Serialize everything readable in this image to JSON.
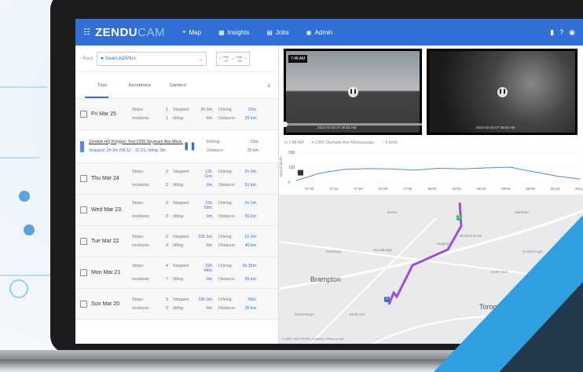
{
  "nav": {
    "logo": "ZENDU",
    "logo_suffix": "CAM",
    "items": [
      {
        "label": "Map",
        "icon": "map-pin-icon"
      },
      {
        "label": "Insights",
        "icon": "chart-icon"
      },
      {
        "label": "Jobs",
        "icon": "document-icon"
      },
      {
        "label": "Admin",
        "icon": "user-icon"
      }
    ]
  },
  "toolbar": {
    "back": "‹ Back",
    "vehicle": "● Sean-ADPlus",
    "date_from_month": "Mar",
    "date_from_day": "20",
    "date_to_month": "Mar",
    "date_to_day": "26"
  },
  "tabs": {
    "trips": "Trips",
    "exceptions": "Exceptions",
    "camera": "Camera"
  },
  "days": [
    {
      "day": "Fri Mar 25",
      "stops": "1",
      "incidents": "1",
      "stopped": "2h 0m",
      "idling": "0m",
      "driving": "23m",
      "distance": "25 km"
    },
    {
      "day": "Thu Mar 24",
      "stops": "2",
      "incidents": "2",
      "stopped": "12h 11m",
      "idling": "0m",
      "driving": "2h 0m",
      "distance": "61 km"
    },
    {
      "day": "Wed Mar 23",
      "stops": "2",
      "incidents": "3",
      "stopped": "22h 59m",
      "idling": "0m",
      "driving": "1h 1m",
      "distance": "50 km"
    },
    {
      "day": "Tue Mar 22",
      "stops": "2",
      "incidents": "3",
      "stopped": "22h 5m",
      "idling": "0m",
      "driving": "1h 2m",
      "distance": "40 km"
    },
    {
      "day": "Mon Mar 21",
      "stops": "4",
      "incidents": "7",
      "stopped": "22h 44m",
      "idling": "0m",
      "driving": "1h 15m",
      "distance": "55 km"
    },
    {
      "day": "Sun Mar 20",
      "stops": "3",
      "incidents": "2",
      "stopped": "23h 0m",
      "idling": "0m",
      "driving": "56m",
      "distance": "26 km"
    }
  ],
  "labels": {
    "stops": "Stops:",
    "incidents": "Incidents:",
    "stopped": "Stopped:",
    "idling": "Idling:",
    "driving": "Driving:",
    "distance": "Distance:"
  },
  "trip": {
    "title": "Zendutt HQ Polygon Test 2355 Skymark Ave,Missi...",
    "sub": "Stopped: 2h 9m (08:12 - 10:21)   Idling: 0m",
    "driving": "23m",
    "distance": "25 km"
  },
  "video": {
    "stamp": "7:48 AM",
    "time1": "2022-03-25 07:48:04 AM",
    "time2": "2022-03-25 07:48:04 AM"
  },
  "info": {
    "time": "7:48 AM",
    "address": "2355 Skymark Ave,Mississauga",
    "speed": "0 km/h"
  },
  "chart_data": {
    "type": "line",
    "ylabel": "Speed (km/h)",
    "ylim": [
      0,
      200
    ],
    "yticks": [
      "200",
      "100",
      "0"
    ],
    "x": [
      "07:50",
      "07:52",
      "07:54",
      "07:56",
      "07:58",
      "08:00",
      "08:02",
      "08:04",
      "08:06",
      "08:08",
      "08:10",
      "08:12"
    ],
    "values": [
      10,
      60,
      85,
      90,
      88,
      80,
      92,
      88,
      95,
      100,
      70,
      40,
      20
    ]
  },
  "map": {
    "brampton": "Brampton",
    "toronto": "Toronto",
    "labels": [
      "Bolton",
      "Kleinburg",
      "Woodbridge",
      "Vaughan",
      "Markham",
      "Etobicoke",
      "Mississauga",
      "Richmond Hill",
      "North York",
      "Scarborough"
    ],
    "footer": "© 1987-2022 HERE | Canada | Terms of use"
  }
}
